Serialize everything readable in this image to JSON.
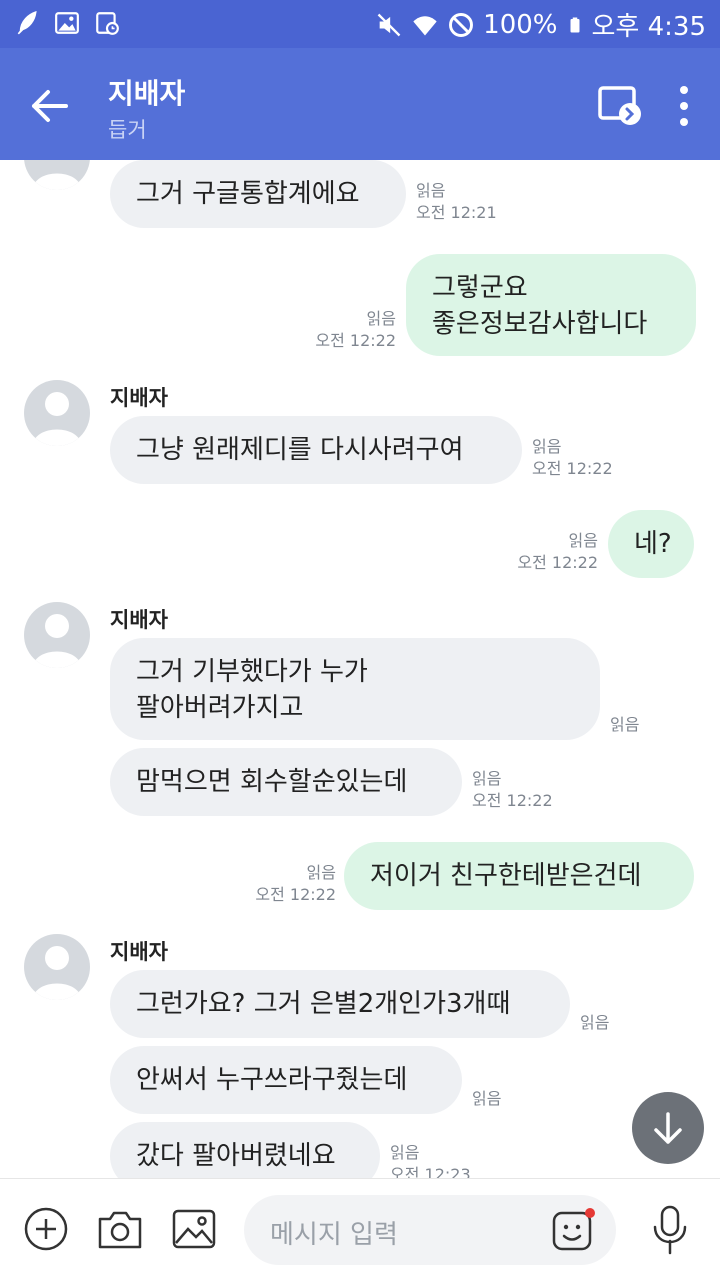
{
  "status_bar": {
    "battery": "100%",
    "time": "오후 4:35",
    "left_icons": [
      "feather-icon",
      "image-icon",
      "calendar-icon"
    ],
    "right_icons": [
      "mute-icon",
      "wifi-icon",
      "block-icon",
      "battery-icon"
    ]
  },
  "header": {
    "title": "지배자",
    "subtitle": "듭거",
    "back_icon": "arrow-left-icon",
    "share_icon": "screen-share-icon",
    "menu_icon": "more-vertical-icon"
  },
  "messages": [
    {
      "dir": "in",
      "text": "그거 구글통합계에요",
      "read": "읽음",
      "time": "오전 12:21"
    },
    {
      "dir": "out",
      "text": "그렇군요\n좋은정보감사합니다",
      "read": "읽음",
      "time": "오전 12:22"
    },
    {
      "dir": "in",
      "sender": "지배자",
      "text": "그냥 원래제디를 다시사려구여",
      "read": "읽음",
      "time": "오전 12:22"
    },
    {
      "dir": "out",
      "text": "네?",
      "read": "읽음",
      "time": "오전 12:22"
    },
    {
      "dir": "in",
      "sender": "지배자",
      "text": "그거 기부했다가 누가\n팔아버려가지고",
      "read": "읽음"
    },
    {
      "dir": "in",
      "text": "맘먹으면 회수할순있는데",
      "read": "읽음",
      "time": "오전 12:22"
    },
    {
      "dir": "out",
      "text": "저이거 친구한테받은건데",
      "read": "읽음",
      "time": "오전 12:22"
    },
    {
      "dir": "in",
      "sender": "지배자",
      "text": "그런가요? 그거 은별2개인가3개때",
      "read": "읽음"
    },
    {
      "dir": "in",
      "text": "안써서 누구쓰라구줬는데",
      "read": "읽음"
    },
    {
      "dir": "in",
      "text": "갔다 팔아버렸네요",
      "read": "읽음",
      "time": "오전 12:23"
    }
  ],
  "input_bar": {
    "placeholder": "메시지 입력",
    "icons": [
      "add-icon",
      "camera-icon",
      "gallery-icon",
      "emoji-icon",
      "mic-icon"
    ]
  },
  "colors": {
    "header": "#5470d8",
    "status_bar": "#4a64d2",
    "incoming_bubble": "#eef0f3",
    "outgoing_bubble": "#dcf5e6",
    "notification_dot": "#e53935"
  }
}
